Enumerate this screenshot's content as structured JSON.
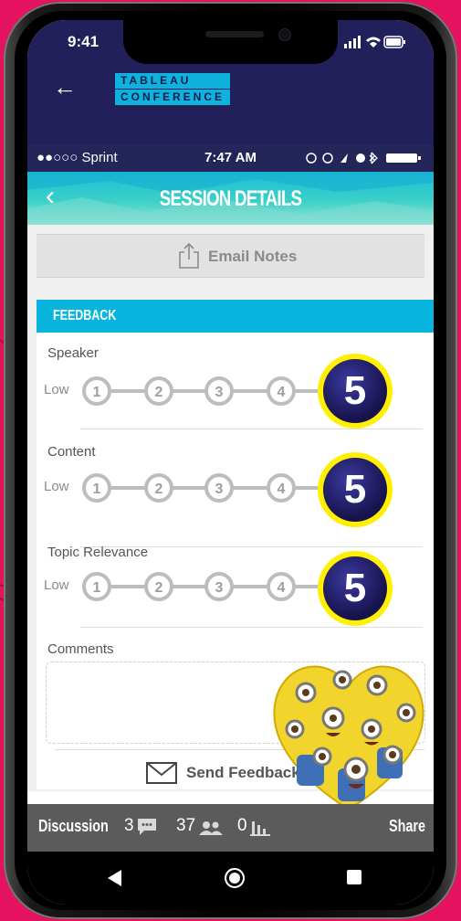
{
  "device": {
    "time": "9:41"
  },
  "app": {
    "logo_line1": "TABLEAU",
    "logo_line2": "CONFERENCE"
  },
  "inner_status": {
    "carrier": "●●○○○ Sprint",
    "time": "7:47 AM"
  },
  "header": {
    "title": "SESSION DETAILS"
  },
  "email_notes": {
    "label": "Email Notes"
  },
  "feedback": {
    "section_label": "FEEDBACK",
    "low_label": "Low",
    "questions": [
      {
        "label": "Speaker",
        "options": [
          "1",
          "2",
          "3",
          "4"
        ],
        "selected": "5"
      },
      {
        "label": "Content",
        "options": [
          "1",
          "2",
          "3",
          "4"
        ],
        "selected": "5"
      },
      {
        "label": "Topic Relevance",
        "options": [
          "1",
          "2",
          "3",
          "4"
        ],
        "selected": "5"
      }
    ],
    "comments_label": "Comments",
    "comments_value": "",
    "send_label": "Send Feedback"
  },
  "bottom_bar": {
    "discussion_label": "Discussion",
    "comment_count": "3",
    "attendee_count": "37",
    "poll_count": "0",
    "share_label": "Share"
  },
  "colors": {
    "accent": "#08b5df",
    "app_bar": "#22205a",
    "highlight": "#ffef00",
    "background": "#e5135f"
  }
}
